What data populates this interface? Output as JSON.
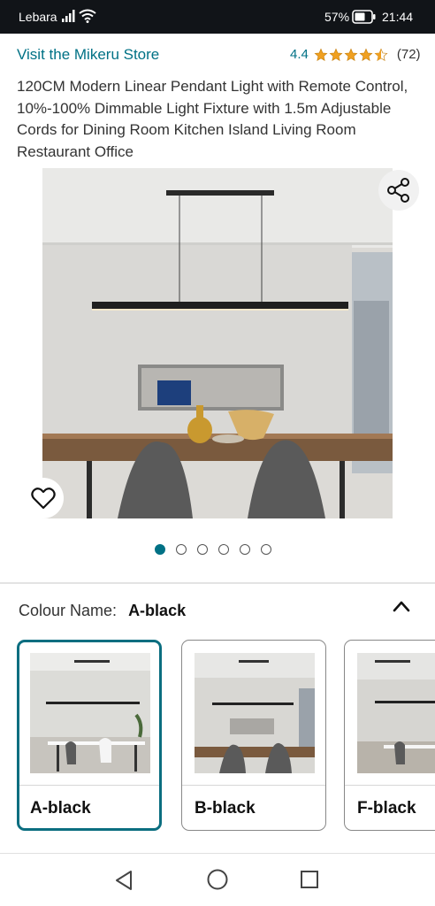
{
  "status_bar": {
    "carrier": "Lebara",
    "battery_percent": "57%",
    "time": "21:44",
    "icons": [
      "signal-icon",
      "wifi-icon",
      "battery-icon"
    ]
  },
  "product": {
    "store_link": "Visit the Mikeru Store",
    "rating_value": "4.4",
    "rating_stars": 4.5,
    "rating_count": "(72)",
    "title": "120CM Modern Linear Pendant Light with Remote Control, 10%-100% Dimmable Light Fixture with 1.5m Adjustable Cords for Dining Room Kitchen Island Living Room Restaurant Office"
  },
  "gallery": {
    "image_count": 6,
    "active_index": 0,
    "share_icon": "share-icon",
    "wishlist_icon": "heart-icon"
  },
  "colour": {
    "label": "Colour Name:",
    "selected": "A-black",
    "collapse_icon": "chevron-up-icon",
    "options": [
      {
        "label": "A-black",
        "selected": true
      },
      {
        "label": "B-black",
        "selected": false
      },
      {
        "label": "F-black",
        "selected": false
      }
    ]
  },
  "nav_bar": {
    "icons": [
      "back-icon",
      "home-icon",
      "recents-icon"
    ]
  },
  "colors": {
    "link": "#007185",
    "star": "#f0a020",
    "selected_border": "#0b6e80",
    "status_bar_bg": "#111418"
  }
}
